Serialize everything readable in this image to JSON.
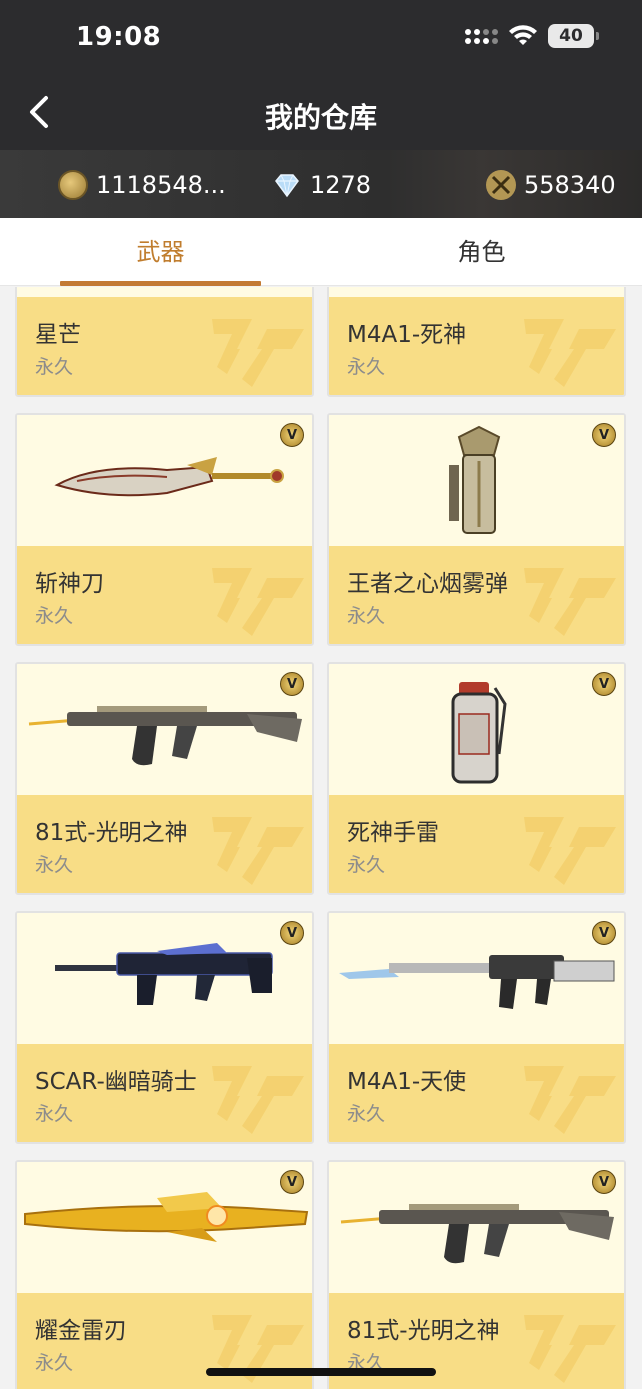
{
  "status": {
    "time": "19:08",
    "battery": "40"
  },
  "nav": {
    "title": "我的仓库"
  },
  "currency": {
    "coins": "1118548...",
    "diamonds": "1278",
    "points": "558340"
  },
  "tabs": [
    {
      "label": "武器"
    },
    {
      "label": "角色"
    }
  ],
  "items": [
    {
      "name": "星芒",
      "duration": "永久"
    },
    {
      "name": "M4A1-死神",
      "duration": "永久"
    },
    {
      "name": "斩神刀",
      "duration": "永久",
      "icon": "knife"
    },
    {
      "name": "王者之心烟雾弹",
      "duration": "永久",
      "icon": "smoke-grenade"
    },
    {
      "name": "81式-光明之神",
      "duration": "永久",
      "icon": "rifle"
    },
    {
      "name": "死神手雷",
      "duration": "永久",
      "icon": "grenade"
    },
    {
      "name": "SCAR-幽暗骑士",
      "duration": "永久",
      "icon": "rifle-dark"
    },
    {
      "name": "M4A1-天使",
      "duration": "永久",
      "icon": "rifle-silver"
    },
    {
      "name": "耀金雷刃",
      "duration": "永久",
      "icon": "gold-blade"
    },
    {
      "name": "81式-光明之神",
      "duration": "永久",
      "icon": "rifle"
    }
  ],
  "colors": {
    "accent": "#c37a34",
    "card_top": "#fffbe3",
    "card_bottom": "#f8dd86"
  }
}
